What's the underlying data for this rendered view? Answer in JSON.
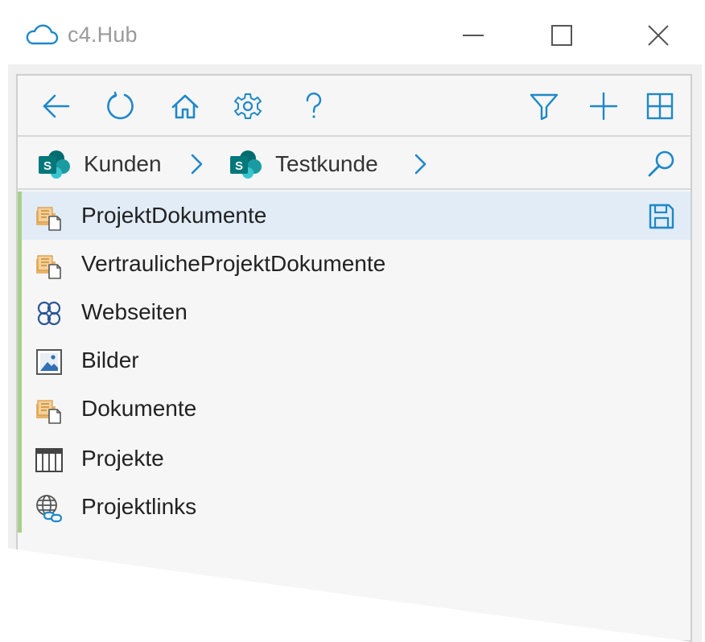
{
  "window": {
    "title": "c4.Hub",
    "icons": {
      "app": "cloud-icon",
      "minimize": "minimize-icon",
      "maximize": "maximize-icon",
      "close": "close-icon"
    }
  },
  "toolbar": {
    "left_icons": [
      "back-arrow-icon",
      "refresh-icon",
      "home-icon",
      "gear-icon",
      "help-icon"
    ],
    "right_icons": [
      "filter-icon",
      "add-icon",
      "grid-view-icon"
    ]
  },
  "breadcrumb": {
    "items": [
      {
        "label": "Kunden",
        "icon": "sharepoint-icon"
      },
      {
        "label": "Testkunde",
        "icon": "sharepoint-icon"
      }
    ],
    "search_icon": "search-icon"
  },
  "list": {
    "items": [
      {
        "label": "ProjektDokumente",
        "icon": "document-library-icon",
        "selected": true,
        "action_icon": "save-icon"
      },
      {
        "label": "VertraulicheProjektDokumente",
        "icon": "document-library-icon",
        "selected": false
      },
      {
        "label": "Webseiten",
        "icon": "sites-icon",
        "selected": false
      },
      {
        "label": "Bilder",
        "icon": "picture-library-icon",
        "selected": false
      },
      {
        "label": "Dokumente",
        "icon": "document-library-icon",
        "selected": false
      },
      {
        "label": "Projekte",
        "icon": "list-table-icon",
        "selected": false
      },
      {
        "label": "Projektlinks",
        "icon": "links-icon",
        "selected": false
      }
    ]
  },
  "colors": {
    "accent": "#1e88c8",
    "selected_row": "#e1ecf7",
    "green_bar": "#a8cf8a",
    "sharepoint_teal": "#0f7b6c",
    "folder_orange": "#e3a14e"
  }
}
